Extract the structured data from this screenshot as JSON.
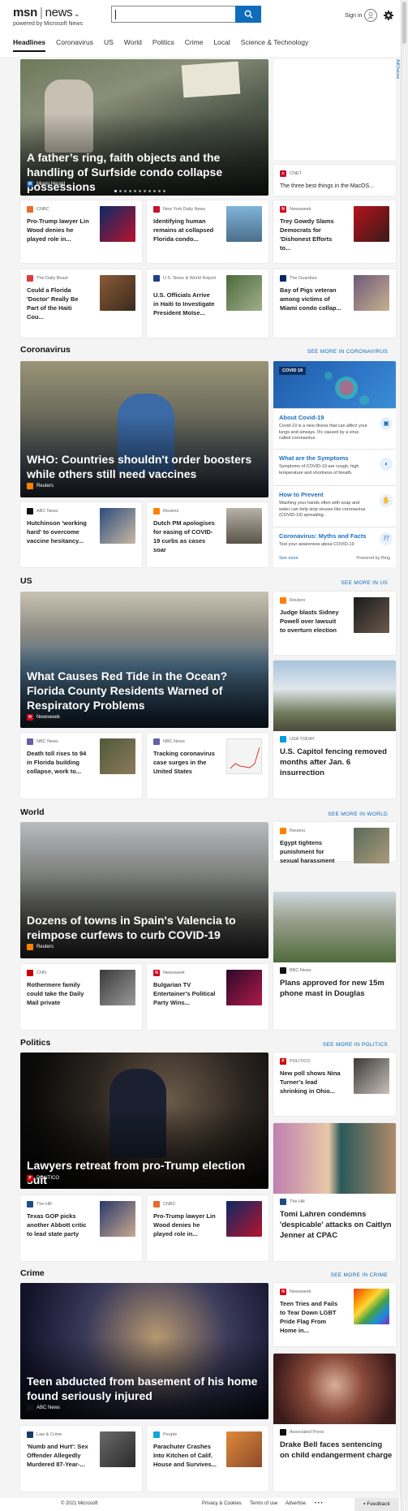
{
  "header": {
    "logo": "msn",
    "section": "news",
    "powered_by": "powered by Microsoft News",
    "search_placeholder": "",
    "sign_in": "Sign in"
  },
  "nav": [
    "Headlines",
    "Coronavirus",
    "US",
    "World",
    "Politics",
    "Crime",
    "Local",
    "Science & Technology"
  ],
  "ad_choices": "AdChoices",
  "headlines": {
    "hero": {
      "title": "A father’s ring, faith objects and the handling of Surfside condo collapse possessions",
      "source": "Miami Herald"
    },
    "side": {
      "source": "CNET",
      "title": "The three best things in the MacOS..."
    },
    "cards": [
      {
        "source": "CNBC",
        "title": "Pro-Trump lawyer Lin Wood denies he played role in..."
      },
      {
        "source": "New York Daily News",
        "title": "Identifying human remains at collapsed Florida condo..."
      },
      {
        "source": "Newsweek",
        "title": "Trey Gowdy Slams Democrats for 'Dishonest Efforts to..."
      },
      {
        "source": "The Daily Beast",
        "title": "Could a Florida 'Doctor' Really Be Part of the Haiti Cou..."
      },
      {
        "source": "U.S. News & World Report",
        "title": "U.S. Officials Arrive in Haiti to Investigate President Moïse..."
      },
      {
        "source": "The Guardian",
        "title": "Bay of Pigs veteran among victims of Miami condo collap..."
      }
    ]
  },
  "coronavirus": {
    "heading": "Coronavirus",
    "see_more": "SEE MORE IN CORONAVIRUS",
    "hero": {
      "title": "WHO: Countries shouldn't order boosters while others still need vaccines",
      "source": "Reuters"
    },
    "cards": [
      {
        "source": "ABC News",
        "title": "Hutchinson 'working hard' to overcome vaccine hesitancy..."
      },
      {
        "source": "Reuters",
        "title": "Dutch PM apologises for easing of COVID-19 curbs as cases soar"
      }
    ],
    "widget": {
      "tag": "COVID 19",
      "items": [
        {
          "title": "About Covid-19",
          "desc": "Covid-19 is a new illness that can affect your lungs and airways. It's caused by a virus called coronavirus."
        },
        {
          "title": "What are the Symptoms",
          "desc": "Symptoms of COVID-19 are cough, high temperature and shortness of breath."
        },
        {
          "title": "How to Prevent",
          "desc": "Washing your hands often with soap and water can help stop viruses like coronavirus (COVID-19) spreading."
        },
        {
          "title": "Coronavirus: Myths and Facts",
          "desc": "Test your awareness about COVID-19"
        }
      ],
      "see_more": "See more",
      "powered": "Powered by Bing"
    }
  },
  "us": {
    "heading": "US",
    "see_more": "SEE MORE IN US",
    "hero": {
      "title": "What Causes Red Tide in the Ocean? Florida County Residents Warned of Respiratory Problems",
      "source": "Newsweek"
    },
    "side": {
      "source": "Reuters",
      "title": "Judge blasts Sidney Powell over lawsuit to overturn election"
    },
    "tall": {
      "source": "USA TODAY",
      "title": "U.S. Capitol fencing removed months after Jan. 6 insurrection"
    },
    "cards": [
      {
        "source": "NBC News",
        "title": "Death toll rises to 94 in Florida building collapse, work to..."
      },
      {
        "source": "NBC News",
        "title": "Tracking coronavirus case surges in the United States"
      }
    ]
  },
  "world": {
    "heading": "World",
    "see_more": "SEE MORE IN WORLD",
    "hero": {
      "title": "Dozens of towns in Spain's Valencia to reimpose curfews to curb COVID-19",
      "source": "Reuters"
    },
    "side": {
      "source": "Reuters",
      "title": "Egypt tightens punishment for sexual harassment"
    },
    "tall": {
      "source": "BBC News",
      "title": "Plans approved for new 15m phone mast in Douglas"
    },
    "cards": [
      {
        "source": "CNN",
        "title": "Rothermere family could take the Daily Mail private"
      },
      {
        "source": "Newsweek",
        "title": "Bulgarian TV Entertainer's Political Party Wins..."
      }
    ]
  },
  "politics": {
    "heading": "Politics",
    "see_more": "SEE MORE IN POLITICS",
    "hero": {
      "title": "Lawyers retreat from pro-Trump election suit",
      "source": "POLITICO"
    },
    "side": {
      "source": "POLITICO",
      "title": "New poll shows Nina Turner's lead shrinking in Ohio..."
    },
    "tall": {
      "source": "The Hill",
      "title": "Tomi Lahren condemns 'despicable' attacks on Caitlyn Jenner at CPAC"
    },
    "cards": [
      {
        "source": "The Hill",
        "title": "Texas GOP picks another Abbott critic to lead state party"
      },
      {
        "source": "CNBC",
        "title": "Pro-Trump lawyer Lin Wood denies he played role in..."
      }
    ]
  },
  "crime": {
    "heading": "Crime",
    "see_more": "SEE MORE IN CRIME",
    "hero": {
      "title": "Teen abducted from basement of his home found seriously injured",
      "source": "ABC News"
    },
    "side": {
      "source": "Newsweek",
      "title": "Teen Tries and Fails to Tear Down LGBT Pride Flag From Home in..."
    },
    "tall": {
      "source": "Associated Press",
      "title": "Drake Bell faces sentencing on child endangerment charge"
    },
    "cards": [
      {
        "source": "Law & Crime",
        "title": "'Numb and Hurt': Sex Offender Allegedly Murdered 87-Year-..."
      },
      {
        "source": "People",
        "title": "Parachuter Crashes Into Kitchen of Calif. House and Survives..."
      }
    ]
  },
  "footer": {
    "copyright": "© 2021 Microsoft",
    "privacy": "Privacy & Cookies",
    "terms": "Terms of use",
    "advertise": "Advertise",
    "more": "• • •",
    "feedback": "Feedback"
  }
}
